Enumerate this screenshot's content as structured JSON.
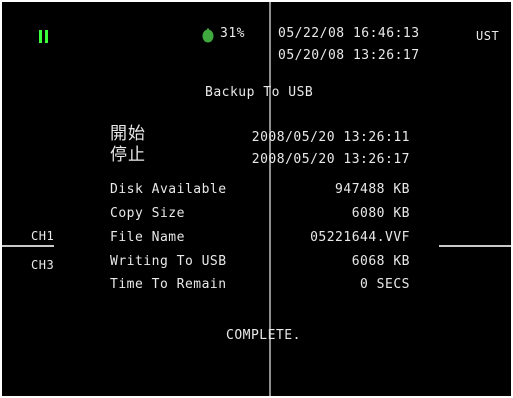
{
  "status": {
    "battery_pct": "31%",
    "time_top": "05/22/08 16:46:13",
    "time_bottom": "05/20/08 13:26:17",
    "tz": "UST",
    "pause_color": "#3cff3c",
    "icon_color": "#3fa83f"
  },
  "dialog": {
    "title": "Backup To USB",
    "start_label": "開始",
    "start_value": "2008/05/20 13:26:11",
    "stop_label": "停止",
    "stop_value": "2008/05/20 13:26:17",
    "disk_label": "Disk Available",
    "disk_value": "947488 KB",
    "copy_label": "Copy Size",
    "copy_value": "6080 KB",
    "file_label": "File Name",
    "file_value": "05221644.VVF",
    "writing_label": "Writing To USB",
    "writing_value": "6068 KB",
    "remain_label": "Time To Remain",
    "remain_value": "0 SECS",
    "status_text": "COMPLETE."
  },
  "channels": {
    "ch_top": "CH1",
    "ch_bottom": "CH3"
  }
}
